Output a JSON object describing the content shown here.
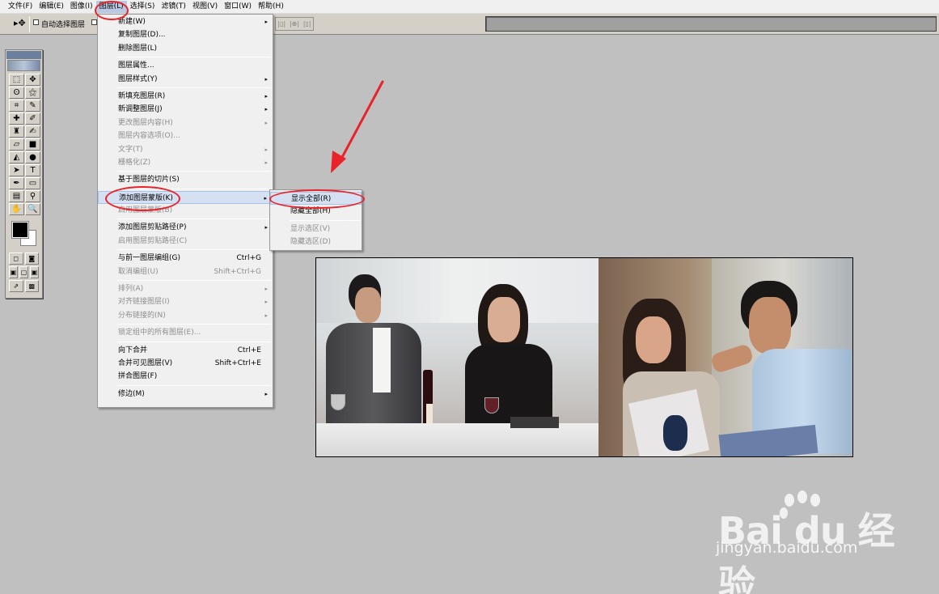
{
  "menubar": {
    "items": [
      "文件(F)",
      "编辑(E)",
      "图像(I)",
      "图层(L)",
      "选择(S)",
      "滤镜(T)",
      "视图(V)",
      "窗口(W)",
      "帮助(H)"
    ],
    "active_index": 3
  },
  "options_bar": {
    "auto_select_label": "自动选择图层",
    "align_icons": [
      "align-left-icon",
      "align-center-icon",
      "align-right-icon"
    ]
  },
  "toolbox": {
    "tools": [
      "marquee-icon",
      "move-icon",
      "lasso-icon",
      "magic-wand-icon",
      "crop-icon",
      "slice-icon",
      "healing-brush-icon",
      "brush-icon",
      "clone-stamp-icon",
      "history-brush-icon",
      "eraser-icon",
      "gradient-icon",
      "blur-icon",
      "dodge-icon",
      "path-select-icon",
      "type-icon",
      "pen-icon",
      "rectangle-icon",
      "notes-icon",
      "eyedropper-icon",
      "hand-icon",
      "zoom-icon"
    ],
    "glyphs": [
      "⬚",
      "✥",
      "ʘ",
      "⚝",
      "⌗",
      "✎",
      "✚",
      "✐",
      "♜",
      "✍",
      "▱",
      "■",
      "◭",
      "●",
      "➤",
      "T",
      "✒",
      "▭",
      "▤",
      "⚲",
      "✋",
      "🔍"
    ]
  },
  "layer_menu": {
    "items": [
      {
        "label": "新建(W)",
        "submenu": true,
        "disabled": false
      },
      {
        "label": "复制图层(D)...",
        "disabled": false
      },
      {
        "label": "删除图层(L)",
        "disabled": false
      },
      {
        "sep": true
      },
      {
        "label": "图层属性...",
        "disabled": false
      },
      {
        "label": "图层样式(Y)",
        "submenu": true,
        "disabled": false
      },
      {
        "sep": true
      },
      {
        "label": "新填充图层(R)",
        "submenu": true,
        "disabled": false
      },
      {
        "label": "新调整图层(J)",
        "submenu": true,
        "disabled": false
      },
      {
        "label": "更改图层内容(H)",
        "submenu": true,
        "disabled": true
      },
      {
        "label": "图层内容选项(O)...",
        "disabled": true
      },
      {
        "label": "文字(T)",
        "submenu": true,
        "disabled": true
      },
      {
        "label": "栅格化(Z)",
        "submenu": true,
        "disabled": true
      },
      {
        "sep": true
      },
      {
        "label": "基于图层的切片(S)",
        "disabled": false
      },
      {
        "sep": true
      },
      {
        "label": "添加图层蒙版(K)",
        "submenu": true,
        "disabled": false,
        "highlighted": true
      },
      {
        "label": "启用图层蒙版(B)",
        "disabled": true
      },
      {
        "sep": true
      },
      {
        "label": "添加图层剪贴路径(P)",
        "submenu": true,
        "disabled": false
      },
      {
        "label": "启用图层剪贴路径(C)",
        "disabled": true
      },
      {
        "sep": true
      },
      {
        "label": "与前一图层编组(G)",
        "shortcut": "Ctrl+G",
        "disabled": false
      },
      {
        "label": "取消编组(U)",
        "shortcut": "Shift+Ctrl+G",
        "disabled": true
      },
      {
        "sep": true
      },
      {
        "label": "排列(A)",
        "submenu": true,
        "disabled": true
      },
      {
        "label": "对齐链接图层(I)",
        "submenu": true,
        "disabled": true
      },
      {
        "label": "分布链接的(N)",
        "submenu": true,
        "disabled": true
      },
      {
        "sep": true
      },
      {
        "label": "锁定组中的所有图层(E)...",
        "disabled": true
      },
      {
        "sep": true
      },
      {
        "label": "向下合并",
        "shortcut": "Ctrl+E",
        "disabled": false
      },
      {
        "label": "合并可见图层(V)",
        "shortcut": "Shift+Ctrl+E",
        "disabled": false
      },
      {
        "label": "拼合图层(F)",
        "disabled": false
      },
      {
        "sep": true
      },
      {
        "label": "修边(M)",
        "submenu": true,
        "disabled": false
      }
    ]
  },
  "mask_submenu": {
    "items": [
      {
        "label": "显示全部(R)",
        "disabled": false,
        "highlighted": true
      },
      {
        "label": "隐藏全部(H)",
        "disabled": false
      },
      {
        "sep": true
      },
      {
        "label": "显示选区(V)",
        "disabled": true
      },
      {
        "label": "隐藏选区(D)",
        "disabled": true
      }
    ]
  },
  "submenu_arrow": "▸",
  "watermark": {
    "brand": "Bai du 经验",
    "url": "jingyan.baidu.com"
  },
  "annotation_color": "#e8232a",
  "highlight_color": "#d5e1f2"
}
